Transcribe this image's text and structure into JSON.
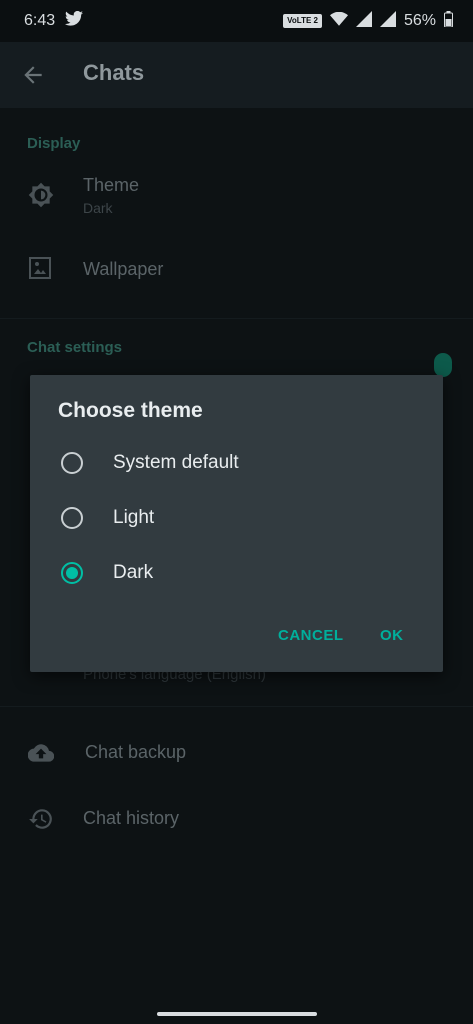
{
  "status": {
    "time": "6:43",
    "volte": "VoLTE 2",
    "battery": "56%",
    "icons": [
      "twitter-icon",
      "wifi-icon",
      "signal-icon",
      "signal-icon",
      "battery-icon"
    ]
  },
  "appbar": {
    "title": "Chats",
    "back_icon": "arrow-back-icon"
  },
  "display": {
    "header": "Display",
    "theme_title": "Theme",
    "theme_value": "Dark",
    "wallpaper": "Wallpaper"
  },
  "chat_settings": {
    "header": "Chat settings",
    "language_value": "Phone's language (English)",
    "backup": "Chat backup",
    "history": "Chat history"
  },
  "dialog": {
    "title": "Choose theme",
    "options": [
      {
        "label": "System default",
        "checked": false
      },
      {
        "label": "Light",
        "checked": false
      },
      {
        "label": "Dark",
        "checked": true
      }
    ],
    "cancel": "CANCEL",
    "ok": "OK"
  },
  "colors": {
    "accent": "#00bfa5",
    "dialog_bg": "#323b40",
    "page_bg": "#0d1214"
  }
}
